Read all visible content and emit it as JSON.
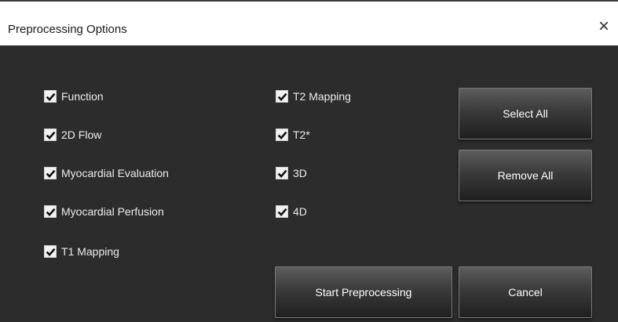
{
  "window": {
    "title": "Preprocessing Options",
    "close_glyph": "×"
  },
  "options_col1": [
    {
      "label": "Function",
      "checked": true
    },
    {
      "label": "2D Flow",
      "checked": true
    },
    {
      "label": "Myocardial Evaluation",
      "checked": true
    },
    {
      "label": "Myocardial Perfusion",
      "checked": true
    },
    {
      "label": "T1 Mapping",
      "checked": true
    }
  ],
  "options_col2": [
    {
      "label": "T2 Mapping",
      "checked": true
    },
    {
      "label": "T2*",
      "checked": true
    },
    {
      "label": "3D",
      "checked": true
    },
    {
      "label": "4D",
      "checked": true
    }
  ],
  "buttons": {
    "select_all": "Select All",
    "remove_all": "Remove All",
    "start_preprocessing": "Start Preprocessing",
    "cancel": "Cancel"
  },
  "icons": {
    "checkmark": "checkmark-icon",
    "close": "close-icon"
  },
  "colors": {
    "background": "#2c2c2c",
    "titlebar": "#ffffff",
    "text": "#ececec"
  }
}
